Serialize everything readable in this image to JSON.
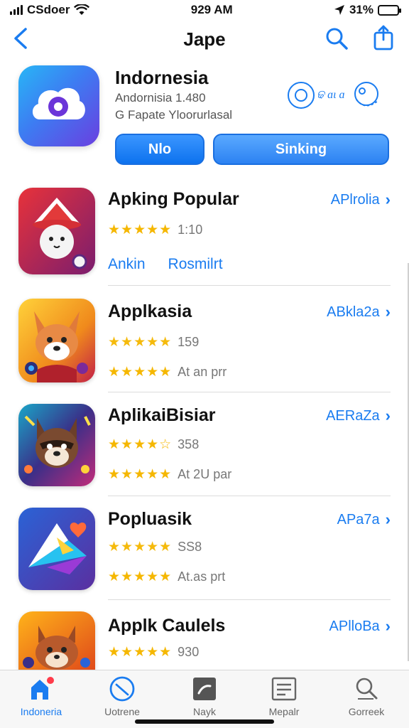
{
  "status_bar": {
    "carrier": "CSdoer",
    "time": "929 AM",
    "battery": "31%",
    "battery_fraction": 0.31,
    "icons": [
      "signal-icon",
      "wifi-icon",
      "location-arrow-icon",
      "battery-icon"
    ]
  },
  "nav": {
    "title": "Jape",
    "back_icon": "chevron-left-icon",
    "search_icon": "search-icon",
    "share_icon": "share-icon"
  },
  "hero": {
    "title": "Indornesia",
    "subtitle": "Andornisia 1.480",
    "meta": "G Fapate Yloorurlasal",
    "badge_text": "ଢ ɑɩ ɑ",
    "buttons": {
      "primary": "Nlo",
      "secondary": "Sinking"
    },
    "colors": {
      "accent": "#1a7cf0"
    }
  },
  "apps": [
    {
      "title": "Apking Popular",
      "link": "APlrolia",
      "rating": 5,
      "rating_text": "1:10",
      "actions": [
        "Ankin",
        "Rosmilrt"
      ]
    },
    {
      "title": "Applkasia",
      "link": "ABkla2a",
      "rating": 4.5,
      "rating_text": "159",
      "rating2": 5,
      "rating2_text": "At an prr"
    },
    {
      "title": "AplikaiBisiar",
      "link": "AERaZa",
      "rating": 4,
      "rating_text": "358",
      "rating2": 5,
      "rating2_text": "At 2U par"
    },
    {
      "title": "Popluasik",
      "link": "APa7a",
      "rating": 4.5,
      "rating_text": "SS8",
      "rating2": 5,
      "rating2_text": "At.as prt"
    },
    {
      "title": "Applk Caulels",
      "link": "APlloBa",
      "rating": 5,
      "rating_text": "930"
    }
  ],
  "tabs": [
    {
      "label": "Indoneria",
      "icon": "home-icon",
      "active": true
    },
    {
      "label": "Uotrene",
      "icon": "compass-icon",
      "active": false
    },
    {
      "label": "Nayk",
      "icon": "app-square-icon",
      "active": false
    },
    {
      "label": "Mepalr",
      "icon": "news-icon",
      "active": false
    },
    {
      "label": "Gorreek",
      "icon": "search-icon",
      "active": false
    }
  ]
}
